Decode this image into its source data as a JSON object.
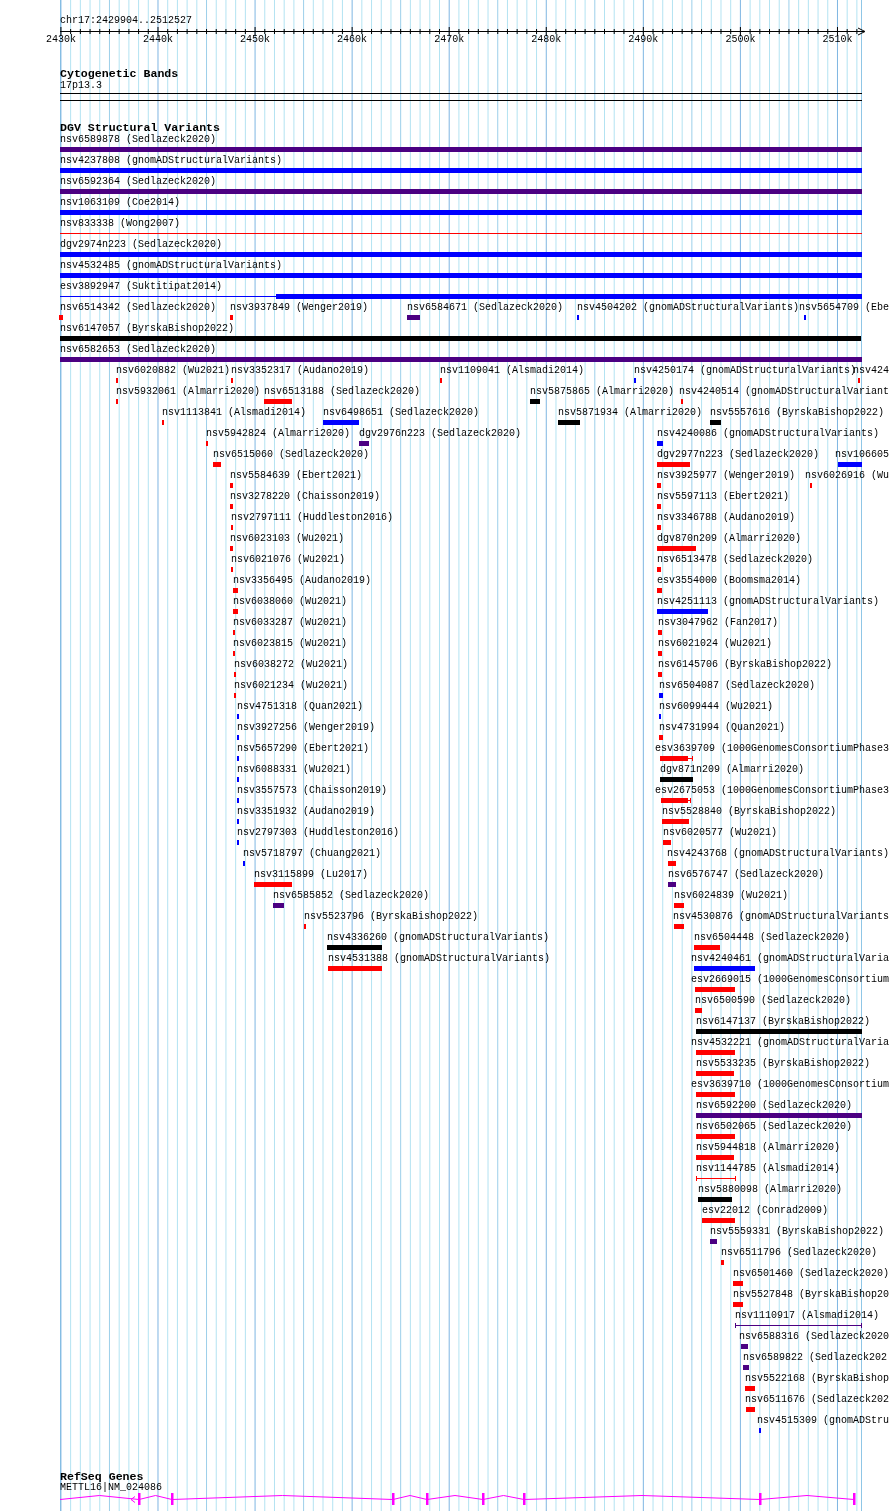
{
  "ruler": {
    "location": "chr17:2429904..2512527",
    "ticks": [
      "2430k",
      "2440k",
      "2450k",
      "2460k",
      "2470k",
      "2480k",
      "2490k",
      "2500k",
      "2510k"
    ]
  },
  "cytogenetic_bands": {
    "title": "Cytogenetic Bands",
    "band": "17p13.3"
  },
  "dgv_structural_variants": {
    "title": "DGV Structural Variants",
    "rows": [
      {
        "features": [
          {
            "label": "nsv6589878 (Sedlazeck2020)",
            "color": "#4b0082",
            "kind": "block"
          }
        ]
      },
      {
        "features": [
          {
            "label": "nsv4237808 (gnomADStructuralVariants)",
            "color": "#0000ff",
            "kind": "block"
          }
        ]
      },
      {
        "features": [
          {
            "label": "nsv6592364 (Sedlazeck2020)",
            "color": "#4b0082",
            "kind": "block"
          }
        ]
      },
      {
        "features": [
          {
            "label": "nsv1063109 (Coe2014)",
            "color": "#0000ff",
            "kind": "block"
          }
        ]
      },
      {
        "features": [
          {
            "label": "nsv833338 (Wong2007)",
            "color": "#ff0000",
            "kind": "line"
          }
        ]
      },
      {
        "features": [
          {
            "label": "dgv2974n223 (Sedlazeck2020)",
            "color": "#0000ff",
            "kind": "block"
          }
        ]
      },
      {
        "features": [
          {
            "label": "nsv4532485 (gnomADStructuralVariants)",
            "color": "#0000ff",
            "kind": "block"
          }
        ]
      },
      {
        "features": [
          {
            "label": "esv3892947 (Suktitipat2014)",
            "color": "#0000ff",
            "kind": "split"
          }
        ]
      },
      {
        "features": [
          {
            "label": "nsv6514342 (Sedlazeck2020)",
            "color": "#ff0000",
            "kind": "block"
          },
          {
            "label": "nsv3937849 (Wenger2019)",
            "color": "#ff0000",
            "kind": "block"
          },
          {
            "label": "nsv6584671 (Sedlazeck2020)",
            "color": "#4b0082",
            "kind": "block"
          },
          {
            "label": "nsv4504202 (gnomADStructuralVariants)",
            "color": "#0000ff",
            "kind": "block"
          },
          {
            "label": "nsv5654709 (Ebe",
            "color": "#0000ff",
            "kind": "block"
          }
        ]
      },
      {
        "features": [
          {
            "label": "nsv6147057 (ByrskaBishop2022)",
            "color": "#000000",
            "kind": "block"
          }
        ]
      },
      {
        "features": [
          {
            "label": "nsv6582653 (Sedlazeck2020)",
            "color": "#4b0082",
            "kind": "block"
          }
        ]
      },
      {
        "features": [
          {
            "label": "nsv6020882 (Wu2021)",
            "color": "#ff0000",
            "kind": "block"
          },
          {
            "label": "nsv3352317 (Audano2019)",
            "color": "#ff0000",
            "kind": "block"
          },
          {
            "label": "nsv1109041 (Alsmadi2014)",
            "color": "#ff0000",
            "kind": "block"
          },
          {
            "label": "nsv4250174 (gnomADStructuralVariants)",
            "color": "#0000ff",
            "kind": "block"
          },
          {
            "label": "nsv424",
            "color": "#ff0000",
            "kind": "block"
          }
        ]
      },
      {
        "features": [
          {
            "label": "nsv5932061 (Almarri2020)",
            "color": "#ff0000",
            "kind": "block"
          },
          {
            "label": "nsv6513188 (Sedlazeck2020)",
            "color": "#ff0000",
            "kind": "block"
          },
          {
            "label": "nsv5875865 (Almarri2020)",
            "color": "#000000",
            "kind": "block"
          },
          {
            "label": "nsv4240514 (gnomADStructuralVariant",
            "color": "#ff0000",
            "kind": "block"
          }
        ]
      },
      {
        "features": [
          {
            "label": "nsv1113841 (Alsmadi2014)",
            "color": "#ff0000",
            "kind": "block"
          },
          {
            "label": "nsv6498651 (Sedlazeck2020)",
            "color": "#0000ff",
            "kind": "block"
          },
          {
            "label": "nsv5871934 (Almarri2020)",
            "color": "#000000",
            "kind": "block"
          },
          {
            "label": "nsv5557616 (ByrskaBishop2022)",
            "color": "#000000",
            "kind": "block"
          }
        ]
      },
      {
        "features": [
          {
            "label": "nsv5942824 (Almarri2020)",
            "color": "#ff0000",
            "kind": "block"
          },
          {
            "label": "dgv2976n223 (Sedlazeck2020)",
            "color": "#4b0082",
            "kind": "block"
          },
          {
            "label": "nsv4240086 (gnomADStructuralVariants)",
            "color": "#0000ff",
            "kind": "block"
          }
        ]
      },
      {
        "features": [
          {
            "label": "nsv6515060 (Sedlazeck2020)",
            "color": "#ff0000",
            "kind": "block"
          },
          {
            "label": "dgv2977n223 (Sedlazeck2020)",
            "color": "#ff0000",
            "kind": "block"
          },
          {
            "label": "nsv106605",
            "color": "#0000ff",
            "kind": "block"
          }
        ]
      },
      {
        "features": [
          {
            "label": "nsv5584639 (Ebert2021)",
            "color": "#ff0000",
            "kind": "block"
          },
          {
            "label": "nsv3925977 (Wenger2019)",
            "color": "#ff0000",
            "kind": "block"
          },
          {
            "label": "nsv6026916 (Wu",
            "color": "#ff0000",
            "kind": "block"
          }
        ]
      },
      {
        "features": [
          {
            "label": "nsv3278220 (Chaisson2019)",
            "color": "#ff0000",
            "kind": "block"
          },
          {
            "label": "nsv5597113 (Ebert2021)",
            "color": "#ff0000",
            "kind": "block"
          }
        ]
      },
      {
        "features": [
          {
            "label": "nsv2797111 (Huddleston2016)",
            "color": "#ff0000",
            "kind": "block"
          },
          {
            "label": "nsv3346788 (Audano2019)",
            "color": "#ff0000",
            "kind": "block"
          }
        ]
      },
      {
        "features": [
          {
            "label": "nsv6023103 (Wu2021)",
            "color": "#ff0000",
            "kind": "block"
          },
          {
            "label": "dgv870n209 (Almarri2020)",
            "color": "#ff0000",
            "kind": "block"
          }
        ]
      },
      {
        "features": [
          {
            "label": "nsv6021076 (Wu2021)",
            "color": "#ff0000",
            "kind": "block"
          },
          {
            "label": "nsv6513478 (Sedlazeck2020)",
            "color": "#ff0000",
            "kind": "block"
          }
        ]
      },
      {
        "features": [
          {
            "label": "nsv3356495 (Audano2019)",
            "color": "#ff0000",
            "kind": "block"
          },
          {
            "label": "esv3554000 (Boomsma2014)",
            "color": "#ff0000",
            "kind": "block"
          }
        ]
      },
      {
        "features": [
          {
            "label": "nsv6038060 (Wu2021)",
            "color": "#ff0000",
            "kind": "block"
          },
          {
            "label": "nsv4251113 (gnomADStructuralVariants)",
            "color": "#0000ff",
            "kind": "block"
          }
        ]
      },
      {
        "features": [
          {
            "label": "nsv6033287 (Wu2021)",
            "color": "#ff0000",
            "kind": "block"
          },
          {
            "label": "nsv3047962 (Fan2017)",
            "color": "#ff0000",
            "kind": "block"
          }
        ]
      },
      {
        "features": [
          {
            "label": "nsv6023815 (Wu2021)",
            "color": "#ff0000",
            "kind": "block"
          },
          {
            "label": "nsv6021024 (Wu2021)",
            "color": "#ff0000",
            "kind": "block"
          }
        ]
      },
      {
        "features": [
          {
            "label": "nsv6038272 (Wu2021)",
            "color": "#ff0000",
            "kind": "block"
          },
          {
            "label": "nsv6145706 (ByrskaBishop2022)",
            "color": "#ff0000",
            "kind": "block"
          }
        ]
      },
      {
        "features": [
          {
            "label": "nsv6021234 (Wu2021)",
            "color": "#ff0000",
            "kind": "block"
          },
          {
            "label": "nsv6504087 (Sedlazeck2020)",
            "color": "#0000ff",
            "kind": "block"
          }
        ]
      },
      {
        "features": [
          {
            "label": "nsv4751318 (Quan2021)",
            "color": "#0000ff",
            "kind": "block"
          },
          {
            "label": "nsv6099444 (Wu2021)",
            "color": "#0000ff",
            "kind": "block"
          }
        ]
      },
      {
        "features": [
          {
            "label": "nsv3927256 (Wenger2019)",
            "color": "#0000ff",
            "kind": "block"
          },
          {
            "label": "nsv4731994 (Quan2021)",
            "color": "#ff0000",
            "kind": "block"
          }
        ]
      },
      {
        "features": [
          {
            "label": "nsv5657290 (Ebert2021)",
            "color": "#0000ff",
            "kind": "block"
          },
          {
            "label": "esv3639709 (1000GenomesConsortiumPhase3",
            "color": "#ff0000",
            "kind": "tailed"
          }
        ]
      },
      {
        "features": [
          {
            "label": "nsv6088331 (Wu2021)",
            "color": "#0000ff",
            "kind": "block"
          },
          {
            "label": "dgv871n209 (Almarri2020)",
            "color": "#000000",
            "kind": "block"
          }
        ]
      },
      {
        "features": [
          {
            "label": "nsv3557573 (Chaisson2019)",
            "color": "#0000ff",
            "kind": "block"
          },
          {
            "label": "esv2675053 (1000GenomesConsortiumPhase3",
            "color": "#ff0000",
            "kind": "tailed"
          }
        ]
      },
      {
        "features": [
          {
            "label": "nsv3351932 (Audano2019)",
            "color": "#0000ff",
            "kind": "block"
          },
          {
            "label": "nsv5528840 (ByrskaBishop2022)",
            "color": "#ff0000",
            "kind": "block"
          }
        ]
      },
      {
        "features": [
          {
            "label": "nsv2797303 (Huddleston2016)",
            "color": "#0000ff",
            "kind": "block"
          },
          {
            "label": "nsv6020577 (Wu2021)",
            "color": "#ff0000",
            "kind": "block"
          }
        ]
      },
      {
        "features": [
          {
            "label": "nsv5718797 (Chuang2021)",
            "color": "#0000ff",
            "kind": "block"
          },
          {
            "label": "nsv4243768 (gnomADStructuralVariants)",
            "color": "#ff0000",
            "kind": "block"
          }
        ]
      },
      {
        "features": [
          {
            "label": "nsv3115899 (Lu2017)",
            "color": "#ff0000",
            "kind": "block"
          },
          {
            "label": "nsv6576747 (Sedlazeck2020)",
            "color": "#4b0082",
            "kind": "block"
          }
        ]
      },
      {
        "features": [
          {
            "label": "nsv6585852 (Sedlazeck2020)",
            "color": "#4b0082",
            "kind": "block"
          },
          {
            "label": "nsv6024839 (Wu2021)",
            "color": "#ff0000",
            "kind": "block"
          }
        ]
      },
      {
        "features": [
          {
            "label": "nsv5523796 (ByrskaBishop2022)",
            "color": "#ff0000",
            "kind": "block"
          },
          {
            "label": "nsv4530876 (gnomADStructuralVariants",
            "color": "#ff0000",
            "kind": "block"
          }
        ]
      },
      {
        "features": [
          {
            "label": "nsv4336260 (gnomADStructuralVariants)",
            "color": "#000000",
            "kind": "block"
          },
          {
            "label": "nsv6504448 (Sedlazeck2020)",
            "color": "#ff0000",
            "kind": "block"
          }
        ]
      },
      {
        "features": [
          {
            "label": "nsv4531388 (gnomADStructuralVariants)",
            "color": "#ff0000",
            "kind": "block"
          },
          {
            "label": "nsv4240461 (gnomADStructuralVaria",
            "color": "#0000ff",
            "kind": "block"
          }
        ]
      },
      {
        "features": [
          {
            "label": "esv2669015 (1000GenomesConsortium",
            "color": "#ff0000",
            "kind": "block"
          }
        ]
      },
      {
        "features": [
          {
            "label": "nsv6500590 (Sedlazeck2020)",
            "color": "#ff0000",
            "kind": "block"
          }
        ]
      },
      {
        "features": [
          {
            "label": "nsv6147137 (ByrskaBishop2022)",
            "color": "#000000",
            "kind": "block"
          }
        ]
      },
      {
        "features": [
          {
            "label": "nsv4532221 (gnomADStructuralVaria",
            "color": "#ff0000",
            "kind": "block"
          }
        ]
      },
      {
        "features": [
          {
            "label": "nsv5533235 (ByrskaBishop2022)",
            "color": "#ff0000",
            "kind": "block"
          }
        ]
      },
      {
        "features": [
          {
            "label": "esv3639710 (1000GenomesConsortium",
            "color": "#ff0000",
            "kind": "block"
          }
        ]
      },
      {
        "features": [
          {
            "label": "nsv6592200 (Sedlazeck2020)",
            "color": "#4b0082",
            "kind": "block"
          }
        ]
      },
      {
        "features": [
          {
            "label": "nsv6502065 (Sedlazeck2020)",
            "color": "#ff0000",
            "kind": "block"
          }
        ]
      },
      {
        "features": [
          {
            "label": "nsv5944818 (Almarri2020)",
            "color": "#ff0000",
            "kind": "block"
          }
        ]
      },
      {
        "features": [
          {
            "label": "nsv1144785 (Alsmadi2014)",
            "color": "#ff0000",
            "kind": "bracket"
          }
        ]
      },
      {
        "features": [
          {
            "label": "nsv5880098 (Almarri2020)",
            "color": "#000000",
            "kind": "block"
          }
        ]
      },
      {
        "features": [
          {
            "label": "esv22012 (Conrad2009)",
            "color": "#ff0000",
            "kind": "block"
          }
        ]
      },
      {
        "features": [
          {
            "label": "nsv5559331 (ByrskaBishop2022)",
            "color": "#4b0082",
            "kind": "block"
          }
        ]
      },
      {
        "features": [
          {
            "label": "nsv6511796 (Sedlazeck2020)",
            "color": "#ff0000",
            "kind": "block"
          }
        ]
      },
      {
        "features": [
          {
            "label": "nsv6501460 (Sedlazeck2020)",
            "color": "#ff0000",
            "kind": "block"
          }
        ]
      },
      {
        "features": [
          {
            "label": "nsv5527848 (ByrskaBishop20",
            "color": "#ff0000",
            "kind": "block"
          }
        ]
      },
      {
        "features": [
          {
            "label": "nsv1110917 (Alsmadi2014)",
            "color": "#4b0082",
            "kind": "bracket"
          }
        ]
      },
      {
        "features": [
          {
            "label": "nsv6588316 (Sedlazeck2020",
            "color": "#4b0082",
            "kind": "block"
          }
        ]
      },
      {
        "features": [
          {
            "label": "nsv6589822 (Sedlazeck202",
            "color": "#4b0082",
            "kind": "block"
          }
        ]
      },
      {
        "features": [
          {
            "label": "nsv5522168 (ByrskaBishop",
            "color": "#ff0000",
            "kind": "block"
          }
        ]
      },
      {
        "features": [
          {
            "label": "nsv6511676 (Sedlazeck202",
            "color": "#ff0000",
            "kind": "block"
          }
        ]
      },
      {
        "features": [
          {
            "label": "nsv4515309 (gnomADStru",
            "color": "#0000ff",
            "kind": "block"
          }
        ]
      }
    ]
  },
  "refseq_genes": {
    "title": "RefSeq Genes",
    "transcript": "METTL16|NM_024086"
  }
}
